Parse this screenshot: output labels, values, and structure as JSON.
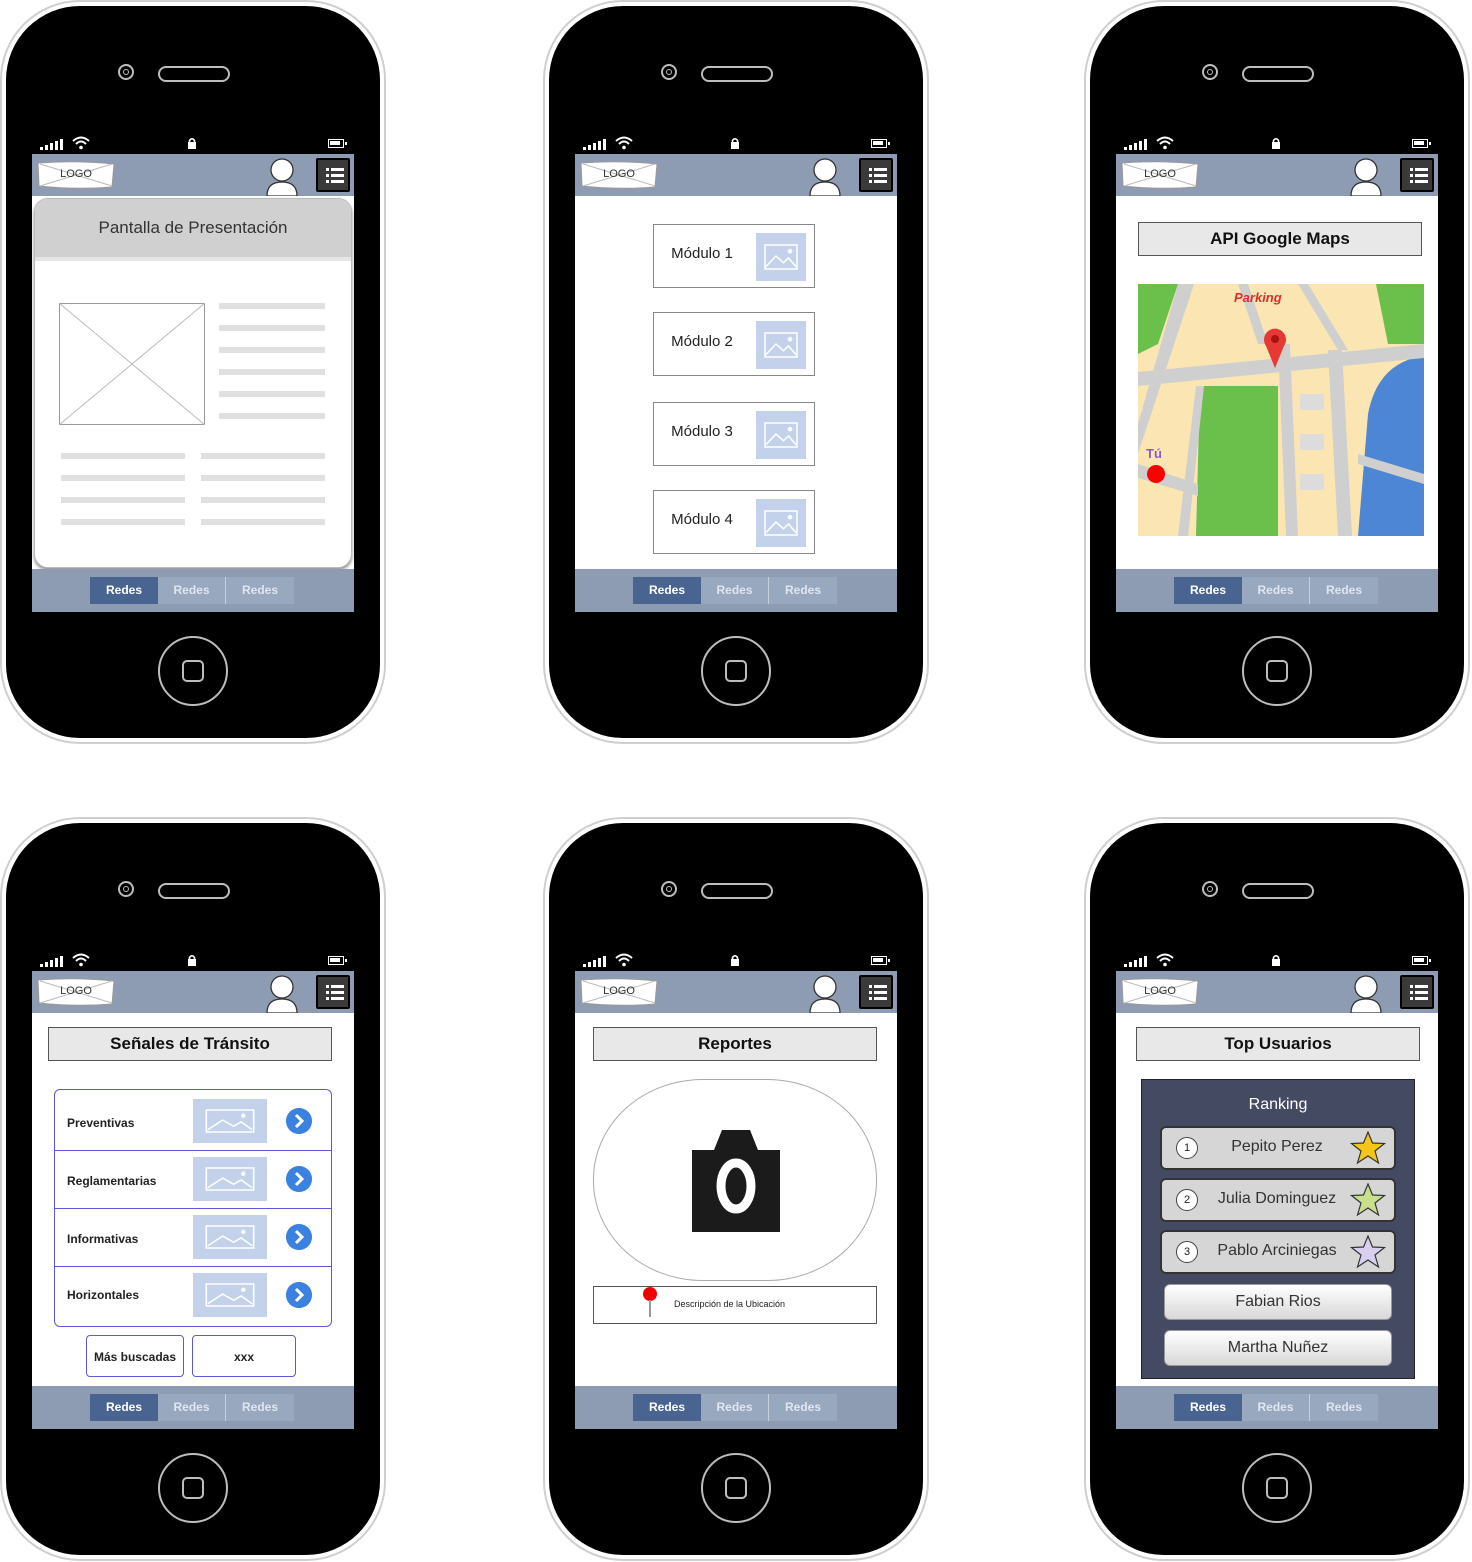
{
  "common": {
    "logo": "LOGO",
    "tabs": [
      "Redes",
      "Redes",
      "Redes"
    ]
  },
  "screens": {
    "presentacion": {
      "title": "Pantalla de Presentación"
    },
    "modulos": {
      "items": [
        "Módulo 1",
        "Módulo 2",
        "Módulo 3",
        "Módulo 4"
      ]
    },
    "mapa": {
      "title": "API Google Maps",
      "parking_label": "Parking",
      "you_label": "Tú"
    },
    "senales": {
      "title": "Señales de Tránsito",
      "items": [
        "Preventivas",
        "Reglamentarias",
        "Informativas",
        "Horizontales"
      ],
      "more_label": "Más buscadas",
      "extra_label": "xxx"
    },
    "reportes": {
      "title": "Reportes",
      "location_label": "Descripción de la Ubicación"
    },
    "top": {
      "title": "Top Usuarios",
      "ranking_title": "Ranking",
      "ranked": [
        {
          "pos": "1",
          "name": "Pepito Perez",
          "star_color": "#f5c518"
        },
        {
          "pos": "2",
          "name": "Julia Dominguez",
          "star_color": "#c8e08c"
        },
        {
          "pos": "3",
          "name": "Pablo Arciniegas",
          "star_color": "#d9d0f0"
        }
      ],
      "others": [
        "Fabian Rios",
        "Martha Nuñez"
      ]
    }
  },
  "colors": {
    "bar": "#8d9cb3",
    "tab_active": "#4a6491",
    "accent_blue": "#3b82e0",
    "map_park": "#6ac04a",
    "map_water": "#4d86d4",
    "map_land": "#fbe6b3"
  }
}
